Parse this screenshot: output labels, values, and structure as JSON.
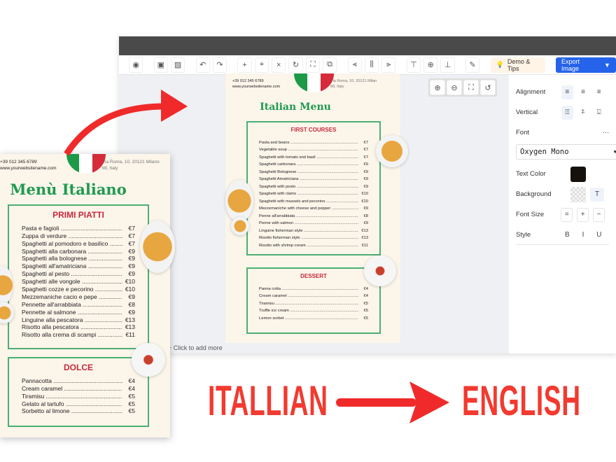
{
  "toolbar": {
    "icons": [
      "eye-icon",
      "select-icon",
      "deselect-icon",
      "undo-icon",
      "redo-icon",
      "add-icon",
      "focus-icon",
      "close-icon",
      "refresh-icon",
      "scan-icon",
      "link-icon",
      "align-left-icon",
      "align-center-icon",
      "align-right-icon",
      "align-top-icon",
      "align-middle-icon",
      "align-bottom-icon",
      "brush-icon"
    ],
    "demo_label": "Demo & Tips",
    "export_label": "Export Image"
  },
  "canvas": {
    "add_more": "+ Click to add more"
  },
  "panel": {
    "alignment": "Alignment",
    "vertical": "Vertical",
    "font": "Font",
    "font_more": "···",
    "font_value": "Oxygen Mono",
    "text_color": "Text Color",
    "text_color_value": "#16110d",
    "background": "Background",
    "bg_t": "T",
    "font_size": "Font Size",
    "size_eq": "=",
    "size_plus": "+",
    "size_minus": "−",
    "style": "Style",
    "bold": "B",
    "italic": "I",
    "underline": "U"
  },
  "english": {
    "phone": "+39 012 345 6789",
    "web": "www.yourwebsitename.com",
    "addr1": "Via Roma, 10, 20121 Milan",
    "addr2": "MI, Italy",
    "title": "Italian Menu",
    "section1": "FIRST COURSES",
    "items1": [
      [
        "Pasta and beans",
        "€7"
      ],
      [
        "Vegetable soup",
        "€7"
      ],
      [
        "Spaghetti with tomato and basil",
        "€7"
      ],
      [
        "Spaghetti carbonara",
        "€9"
      ],
      [
        "Spaghetti Bolognese",
        "€9"
      ],
      [
        "Spaghetti Amatriciana",
        "€9"
      ],
      [
        "Spaghetti with pesto",
        "€9"
      ],
      [
        "Spaghetti with clams",
        "€10"
      ],
      [
        "Spaghetti with mussels and pecorino",
        "€10"
      ],
      [
        "Mezzemaniche with cheese and pepper",
        "€9"
      ],
      [
        "Penne all'arrabbiata",
        "€8"
      ],
      [
        "Penne with salmon",
        "€9"
      ],
      [
        "Linguine fisherman style",
        "€13"
      ],
      [
        "Risotto fisherman style",
        "€13"
      ],
      [
        "Risotto with shrimp cream",
        "€11"
      ]
    ],
    "section2": "DESSERT",
    "items2": [
      [
        "Panna cotta",
        "€4"
      ],
      [
        "Cream caramel",
        "€4"
      ],
      [
        "Tiramisu",
        "€5"
      ],
      [
        "Truffle ice cream",
        "€5"
      ],
      [
        "Lemon sorbet",
        "€5"
      ]
    ]
  },
  "italian": {
    "phone": "+39 012 345 6789",
    "web": "www.yourwebsitename.com",
    "addr1": "Via Roma, 10, 20121 Milano",
    "addr2": "MI, Italy",
    "title": "Menù Italiano",
    "section1": "PRIMI PIATTI",
    "items1": [
      [
        "Pasta e fagioli",
        "€7"
      ],
      [
        "Zuppa di verdure",
        "€7"
      ],
      [
        "Spaghetti al pomodoro e basilico",
        "€7"
      ],
      [
        "Spaghetti alla carbonara",
        "€9"
      ],
      [
        "Spaghetti alla bolognese",
        "€9"
      ],
      [
        "Spaghetti all'amatriciana",
        "€9"
      ],
      [
        "Spaghetti al pesto",
        "€9"
      ],
      [
        "Spaghetti alle vongole",
        "€10"
      ],
      [
        "Spaghetti cozze e pecorino",
        "€10"
      ],
      [
        "Mezzemaniche cacio e pepe",
        "€9"
      ],
      [
        "Pennette all'arrabbiata",
        "€8"
      ],
      [
        "Pennette al salmone",
        "€9"
      ],
      [
        "Linguine alla pescatora",
        "€13"
      ],
      [
        "Risotto alla pescatora",
        "€13"
      ],
      [
        "Risotto alla crema di scampi",
        "€11"
      ]
    ],
    "section2": "DOLCE",
    "items2": [
      [
        "Pannacotta",
        "€4"
      ],
      [
        "Cream caramel",
        "€4"
      ],
      [
        "Tiramisu",
        "€5"
      ],
      [
        "Gelato al tartufo",
        "€5"
      ],
      [
        "Sorbetto al limone",
        "€5"
      ]
    ]
  },
  "caption": {
    "from": "ITALLIAN",
    "to": "ENGLISH"
  },
  "colors": {
    "accent": "#f23a30",
    "green": "#4caf72",
    "title_green": "#1f9a4f",
    "section_red": "#c8283a",
    "export_blue": "#2563eb"
  }
}
